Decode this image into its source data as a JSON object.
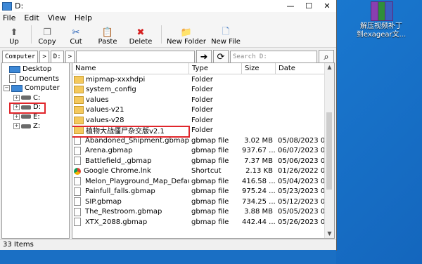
{
  "window": {
    "title": "D:"
  },
  "menu": [
    "File",
    "Edit",
    "View",
    "Help"
  ],
  "toolbar": [
    {
      "label": "Up",
      "icon": "up-arrow-icon",
      "glyph": "⬆",
      "color": "#555555"
    },
    {
      "label": "Copy",
      "icon": "copy-icon",
      "glyph": "❐",
      "color": "#777777"
    },
    {
      "label": "Cut",
      "icon": "scissors-icon",
      "glyph": "✂",
      "color": "#2a63b8"
    },
    {
      "label": "Paste",
      "icon": "paste-icon",
      "glyph": "📋",
      "color": "#b07a2a"
    },
    {
      "label": "Delete",
      "icon": "delete-icon",
      "glyph": "✖",
      "color": "#d62020"
    },
    {
      "label": "New Folder",
      "icon": "new-folder-icon",
      "glyph": "📁",
      "color": "#d9a52b"
    },
    {
      "label": "New File",
      "icon": "new-file-icon",
      "glyph": "🗋",
      "color": "#4a7fc4"
    }
  ],
  "address": {
    "crumbs": [
      "Computer",
      "D:"
    ],
    "search_placeholder": "Search D:"
  },
  "tree": [
    {
      "label": "Desktop",
      "icon": "monitor-icon",
      "expander": ""
    },
    {
      "label": "Documents",
      "icon": "document-icon",
      "expander": ""
    },
    {
      "label": "Computer",
      "icon": "monitor-icon",
      "expander": "−"
    },
    {
      "label": "C:",
      "icon": "drive-icon",
      "expander": "+"
    },
    {
      "label": "D:",
      "icon": "drive-icon",
      "expander": "+"
    },
    {
      "label": "E:",
      "icon": "drive-icon",
      "expander": "+"
    },
    {
      "label": "Z:",
      "icon": "drive-icon",
      "expander": "+"
    }
  ],
  "columns": [
    "Name",
    "Type",
    "Size",
    "Date"
  ],
  "rows": [
    {
      "name": "mipmap-xxxhdpi",
      "type": "Folder",
      "size": "",
      "date": "",
      "icon": "folder"
    },
    {
      "name": "system_config",
      "type": "Folder",
      "size": "",
      "date": "",
      "icon": "folder"
    },
    {
      "name": "values",
      "type": "Folder",
      "size": "",
      "date": "",
      "icon": "folder"
    },
    {
      "name": "values-v21",
      "type": "Folder",
      "size": "",
      "date": "",
      "icon": "folder"
    },
    {
      "name": "values-v28",
      "type": "Folder",
      "size": "",
      "date": "",
      "icon": "folder"
    },
    {
      "name": "植物大战僵尸杂交版v2.1",
      "type": "Folder",
      "size": "",
      "date": "",
      "icon": "folder"
    },
    {
      "name": "Abandoned_Shipment.gbmap",
      "type": "gbmap file",
      "size": "3.02 MB",
      "date": "05/08/2023 04...",
      "icon": "file"
    },
    {
      "name": "Arena.gbmap",
      "type": "gbmap file",
      "size": "937.67 ...",
      "date": "06/07/2023 05...",
      "icon": "file"
    },
    {
      "name": "Battlefield_.gbmap",
      "type": "gbmap file",
      "size": "7.37 MB",
      "date": "05/06/2023 03...",
      "icon": "file"
    },
    {
      "name": "Google Chrome.lnk",
      "type": "Shortcut",
      "size": "2.13 KB",
      "date": "01/26/2022 01...",
      "icon": "lnk"
    },
    {
      "name": "Melon_Playground_Map_Defaul...",
      "type": "gbmap file",
      "size": "416.58 ...",
      "date": "05/04/2023 08...",
      "icon": "file"
    },
    {
      "name": "Painfull_falls.gbmap",
      "type": "gbmap file",
      "size": "975.24 ...",
      "date": "05/23/2023 06...",
      "icon": "file"
    },
    {
      "name": "SIP.gbmap",
      "type": "gbmap file",
      "size": "734.25 ...",
      "date": "05/12/2023 03...",
      "icon": "file"
    },
    {
      "name": "The_Restroom.gbmap",
      "type": "gbmap file",
      "size": "3.88 MB",
      "date": "05/05/2023 03...",
      "icon": "file"
    },
    {
      "name": "XTX_2088.gbmap",
      "type": "gbmap file",
      "size": "442.44 ...",
      "date": "05/26/2023 03...",
      "icon": "file"
    }
  ],
  "status": "33 Items",
  "desktop_icon": {
    "line1": "解压视频补丁",
    "line2": "到exagear文..."
  }
}
